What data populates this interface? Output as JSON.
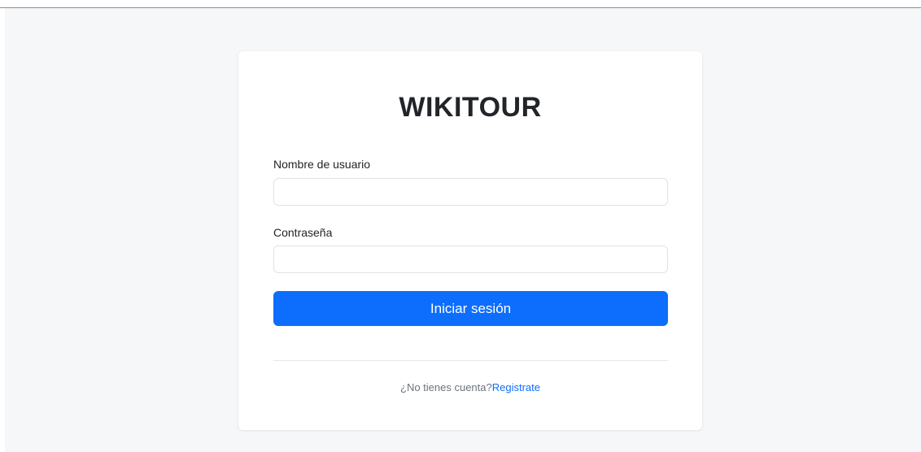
{
  "login": {
    "title": "WIKITOUR",
    "username_label": "Nombre de usuario",
    "username_value": "",
    "password_label": "Contraseña",
    "password_value": "",
    "submit_label": "Iniciar sesión",
    "no_account_text": "¿No tienes cuenta?",
    "register_link": "Registrate"
  },
  "colors": {
    "primary": "#0d6efd",
    "page_background": "#f6f7f9",
    "card_background": "#ffffff",
    "text": "#212529",
    "muted_text": "#6c757d"
  }
}
